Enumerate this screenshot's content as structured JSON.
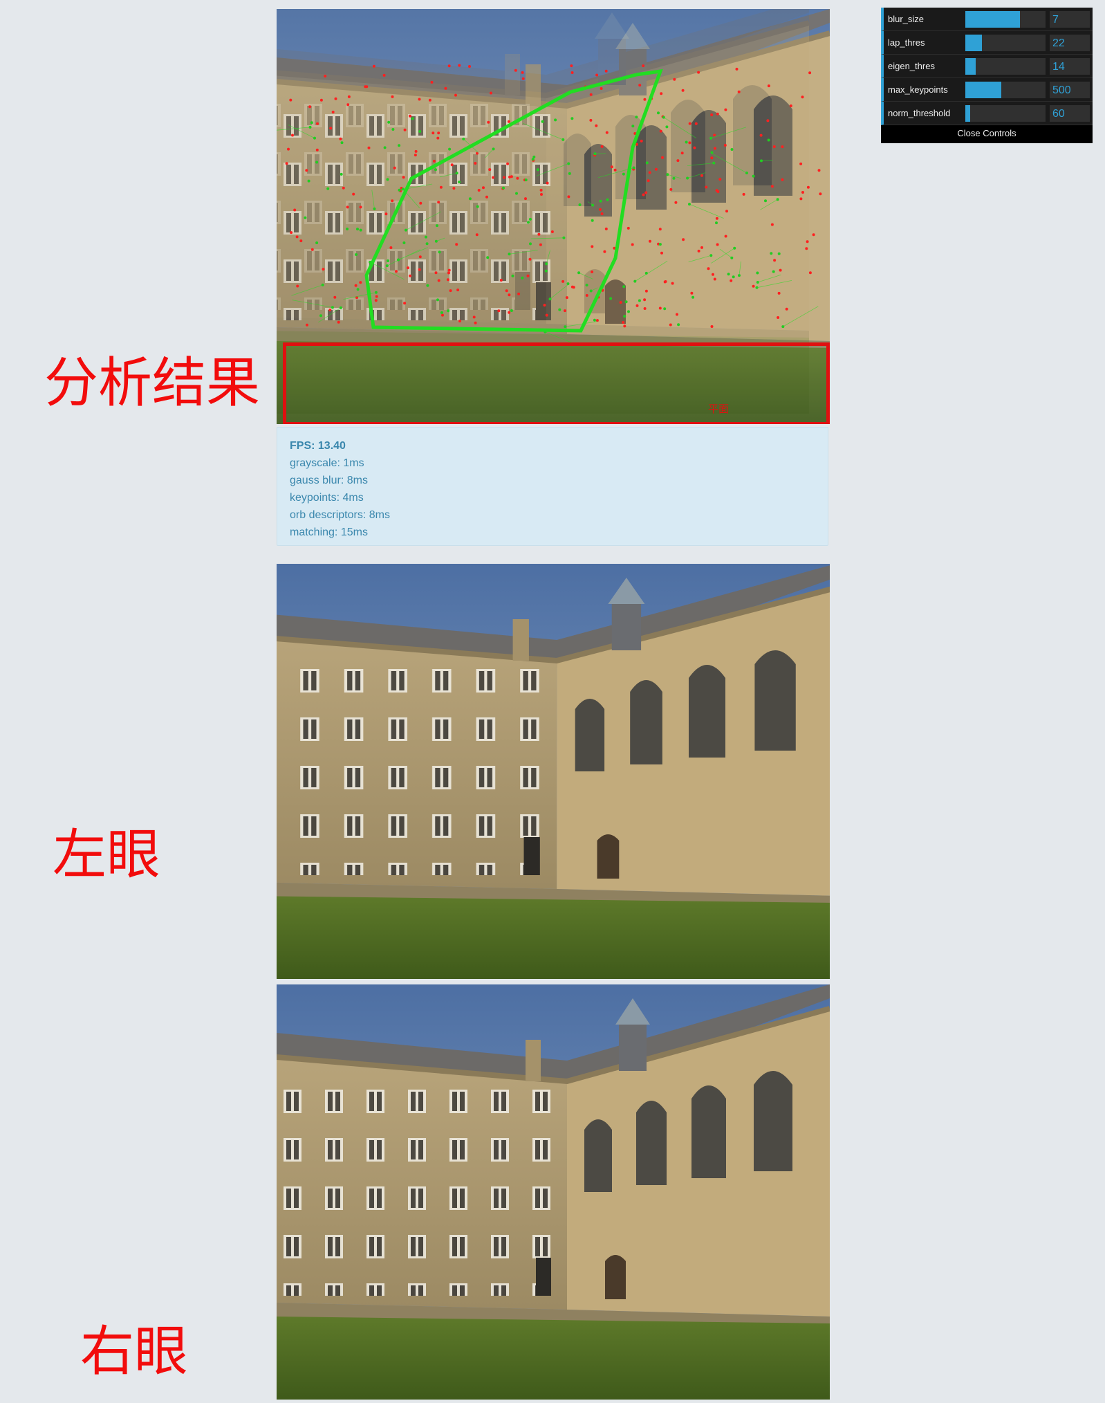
{
  "annotations": {
    "result": "分析结果",
    "left_eye": "左眼",
    "right_eye": "右眼"
  },
  "result_panel": {
    "ground_label": "平面",
    "colors": {
      "highlight": "#e01010",
      "homography": "#22dd22",
      "keypoints_a": "#ff2020",
      "keypoints_b": "#22cc22"
    }
  },
  "stats": {
    "fps": "FPS: 13.40",
    "grayscale": "grayscale: 1ms",
    "gauss_blur": "gauss blur: 8ms",
    "keypoints": "keypoints: 4ms",
    "orb_descriptors": "orb descriptors: 8ms",
    "matching": "matching: 15ms"
  },
  "controls": {
    "items": [
      {
        "label": "blur_size",
        "value": "7",
        "fill_fraction": 0.68
      },
      {
        "label": "lap_thres",
        "value": "22",
        "fill_fraction": 0.21
      },
      {
        "label": "eigen_thres",
        "value": "14",
        "fill_fraction": 0.13
      },
      {
        "label": "max_keypoints",
        "value": "500",
        "fill_fraction": 0.45
      },
      {
        "label": "norm_threshold",
        "value": "60",
        "fill_fraction": 0.06
      }
    ],
    "close_label": "Close Controls",
    "accent": "#2fa1d6"
  }
}
